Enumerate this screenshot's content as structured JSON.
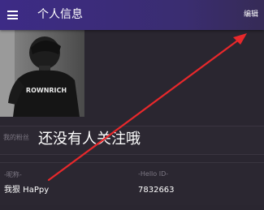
{
  "header": {
    "title": "个人信息",
    "edit_label": "编辑",
    "menu_icon": "hamburger-menu-icon"
  },
  "profile": {
    "avatar_text": "ROWNRICH",
    "followers_label": "我的粉丝",
    "followers_value": "还没有人关注哦",
    "nickname_label": "-昵称-",
    "nickname_value": "我狠 HaPpy",
    "helloid_label": "-Hello ID-",
    "helloid_value": "7832663"
  },
  "colors": {
    "header_bg": "#3d2b86",
    "page_bg": "#2a2630",
    "annotation_arrow": "#e8282b"
  }
}
